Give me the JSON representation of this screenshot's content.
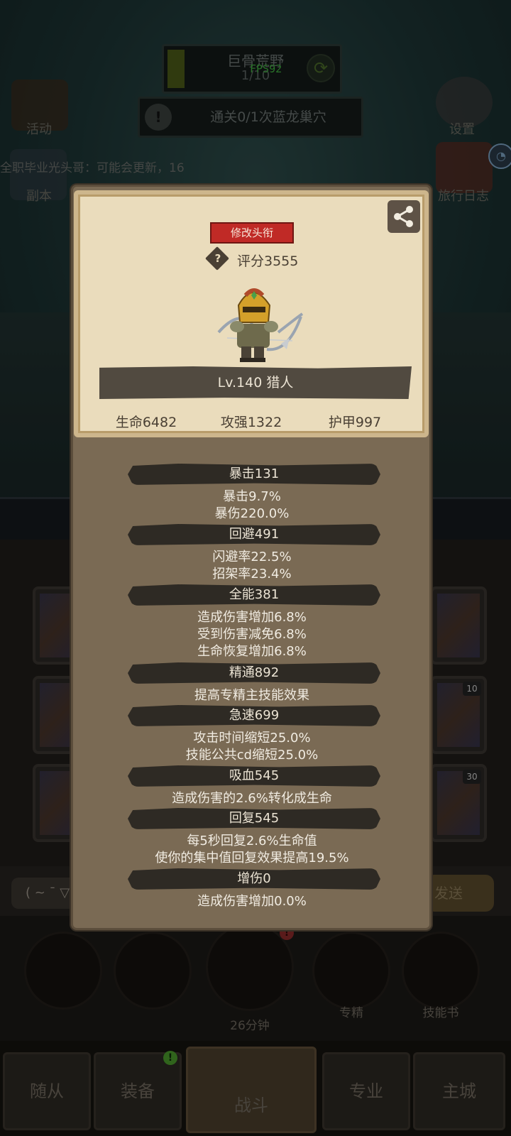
{
  "hud": {
    "map_name": "巨骨荒野",
    "map_progress_text": "1/10",
    "map_progress": 0.1,
    "fps": "FPS92",
    "quest": "通关0/1次蓝龙巢穴",
    "activity": "活动",
    "dungeon": "副本",
    "settings": "设置",
    "travel_log": "旅行日志",
    "chat_scroll": "全职毕业光头哥：可能会更新，16"
  },
  "character": {
    "edit_title_button": "修改头衔",
    "score": "评分3555",
    "level_class": "Lv.140 猎人",
    "hp": "生命6482",
    "attack": "攻强1322",
    "armor": "护甲997"
  },
  "stats": [
    {
      "header": "暴击131",
      "lines": [
        "暴击9.7%",
        "暴伤220.0%"
      ]
    },
    {
      "header": "回避491",
      "lines": [
        "闪避率22.5%",
        "招架率23.4%"
      ]
    },
    {
      "header": "全能381",
      "lines": [
        "造成伤害增加6.8%",
        "受到伤害减免6.8%",
        "生命恢复增加6.8%"
      ]
    },
    {
      "header": "精通892",
      "lines": [
        "提高专精主技能效果"
      ]
    },
    {
      "header": "急速699",
      "lines": [
        "攻击时间缩短25.0%",
        "技能公共cd缩短25.0%"
      ]
    },
    {
      "header": "吸血545",
      "lines": [
        "造成伤害的2.6%转化成生命"
      ]
    },
    {
      "header": "回复545",
      "lines": [
        "每5秒回复2.6%生命值",
        "使你的集中值回复效果提高19.5%"
      ]
    },
    {
      "header": "增伤0",
      "lines": [
        "造成伤害增加0.0%"
      ]
    }
  ],
  "background": {
    "chat_input": "( ~ ¯ ▽",
    "send_button": "发送",
    "card_badge_1": "10",
    "card_badge_2": "30",
    "timer": "26分钟",
    "specialization": "专精",
    "skill_book": "技能书"
  },
  "nav": {
    "followers": "随从",
    "equipment": "装备",
    "battle": "战斗",
    "profession": "专业",
    "main_city": "主城"
  },
  "colors": {
    "title_button": "#c02a26",
    "card_bg": "#eadcbc",
    "panel_bg": "#7a6a54",
    "stat_header_bg": "#2e2a24"
  }
}
